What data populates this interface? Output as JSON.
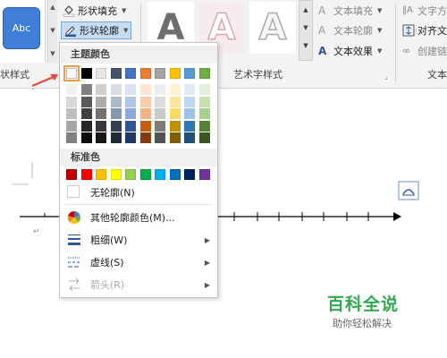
{
  "ribbon": {
    "shape_styles": {
      "abc_label": "Abc",
      "fill_label": "形状填充",
      "outline_label": "形状轮廓",
      "group_label": "状样式"
    },
    "wordart": {
      "glyph": "A",
      "text_fill": "文本填充",
      "text_outline": "文本轮廓",
      "text_effects": "文本效果",
      "group_label": "艺术字样式"
    },
    "text_group": {
      "text_direction": "文字方",
      "align_text": "对齐文",
      "create_link": "创建链",
      "group_label": "文本"
    }
  },
  "dropdown": {
    "theme_colors_header": "主题颜色",
    "standard_colors_header": "标准色",
    "no_outline": "无轮廓(N)",
    "more_colors": "其他轮廓颜色(M)...",
    "weight": "粗细(W)",
    "dashes": "虚线(S)",
    "arrows": "箭头(R)",
    "theme_colors": [
      "#ffffff",
      "#000000",
      "#e7e6e6",
      "#44546a",
      "#4472c4",
      "#ed7d31",
      "#a5a5a5",
      "#ffc000",
      "#5b9bd5",
      "#70ad47"
    ],
    "theme_shades": [
      [
        "#f2f2f2",
        "#d9d9d9",
        "#bfbfbf",
        "#a6a6a6",
        "#808080"
      ],
      [
        "#7f7f7f",
        "#595959",
        "#404040",
        "#262626",
        "#0d0d0d"
      ],
      [
        "#d0cece",
        "#aeabab",
        "#757171",
        "#3a3838",
        "#171616"
      ],
      [
        "#d6dce4",
        "#adb9ca",
        "#8497b0",
        "#333f50",
        "#222a35"
      ],
      [
        "#d9e2f3",
        "#b4c6e7",
        "#8eaadb",
        "#2f5496",
        "#1f3864"
      ],
      [
        "#fbe5d5",
        "#f7cbac",
        "#f4b183",
        "#c55a11",
        "#843c0b"
      ],
      [
        "#ededed",
        "#dbdbdb",
        "#c9c9c9",
        "#7b7b7b",
        "#525252"
      ],
      [
        "#fff2cc",
        "#fee599",
        "#ffd965",
        "#bf9000",
        "#7f6000"
      ],
      [
        "#deebf6",
        "#bdd7ee",
        "#9cc3e5",
        "#2e75b5",
        "#1f4e79"
      ],
      [
        "#e2efd9",
        "#c5e0b3",
        "#a8d08d",
        "#538135",
        "#375623"
      ]
    ],
    "standard_colors": [
      "#c00000",
      "#ff0000",
      "#ffc000",
      "#ffff00",
      "#92d050",
      "#00b050",
      "#00b0f0",
      "#0070c0",
      "#002060",
      "#7030a0"
    ]
  },
  "watermark": {
    "title": "百科全说",
    "subtitle": "助你轻松解决"
  },
  "colors": {
    "accent_arrow": "#e8453c",
    "selection_outline": "#f19a4a",
    "abc_fill": "#3f7fd8"
  }
}
